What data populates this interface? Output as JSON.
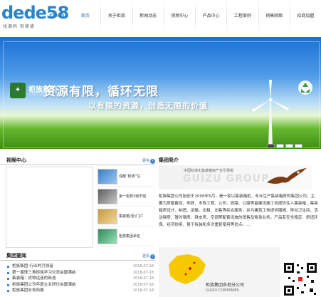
{
  "logo": {
    "main": "dede",
    "num": "58",
    "com": ".com",
    "sub": "找源码  到德德"
  },
  "nav": [
    {
      "label": "首页",
      "active": true
    },
    {
      "label": "关于柜族",
      "active": false
    },
    {
      "label": "新闻动态",
      "active": false
    },
    {
      "label": "视频中心",
      "active": false
    },
    {
      "label": "产品中心",
      "active": false
    },
    {
      "label": "工程案例",
      "active": false
    },
    {
      "label": "销售网络",
      "active": false
    },
    {
      "label": "招商加盟",
      "active": false
    }
  ],
  "banner": {
    "logo_name": "柜族集团",
    "logo_en": "GUIZU GROUP",
    "headline": "资源有限，循环无限",
    "subline": "以有限的资源，创造无限的价值"
  },
  "video": {
    "title": "视频中心",
    "more": "更多",
    "items": [
      {
        "label": "成都“柜族”住"
      },
      {
        "label": "第一柜族3城市馆"
      },
      {
        "label": "集装箱(柜)门户"
      },
      {
        "label": "柜族集团承包"
      }
    ]
  },
  "intro": {
    "title": "集团简介",
    "banner_cn": "中国标准化集装箱房产业引领者",
    "banner_en": "GUIZU GROUP",
    "text": "柜族集团公司始创于2008年5月，是一家以集装箱柜、专业生产集装箱房的集团公司。主要为房屋建设、地铁、市政工程、公安、铁路、公路等基建设施工地提供住人集装箱，集装箱房设计、制造、运输、出租、出售等综合服务，并为建筑工地提供围墙、移动卫生间、活动钢房、暂时钢房、铁皮房、空调等配套设施的销售及租赁业务。产品有安全稳定、舒适环保、经济耐用、易于拆装和多次重复使用等优点。..."
  },
  "company": {
    "name": "柜族集团各地分公司",
    "en": "GUIZU COMPANIES"
  },
  "news": {
    "title": "集团要闻",
    "more": "更多",
    "items": [
      {
        "title": "柜族集团-行业的引领者",
        "date": "2018-07-18"
      },
      {
        "title": "第一届珠三角柜族学习交流会圆满结",
        "date": "2018-07-18"
      },
      {
        "title": "集装箱：货物运送的新选",
        "date": "2018-07-18"
      },
      {
        "title": "柜族集团公司年度企业研讨会圆满结",
        "date": "2018-07-18"
      },
      {
        "title": "柜族集团业务拓展",
        "date": "2018-07-18"
      }
    ]
  }
}
